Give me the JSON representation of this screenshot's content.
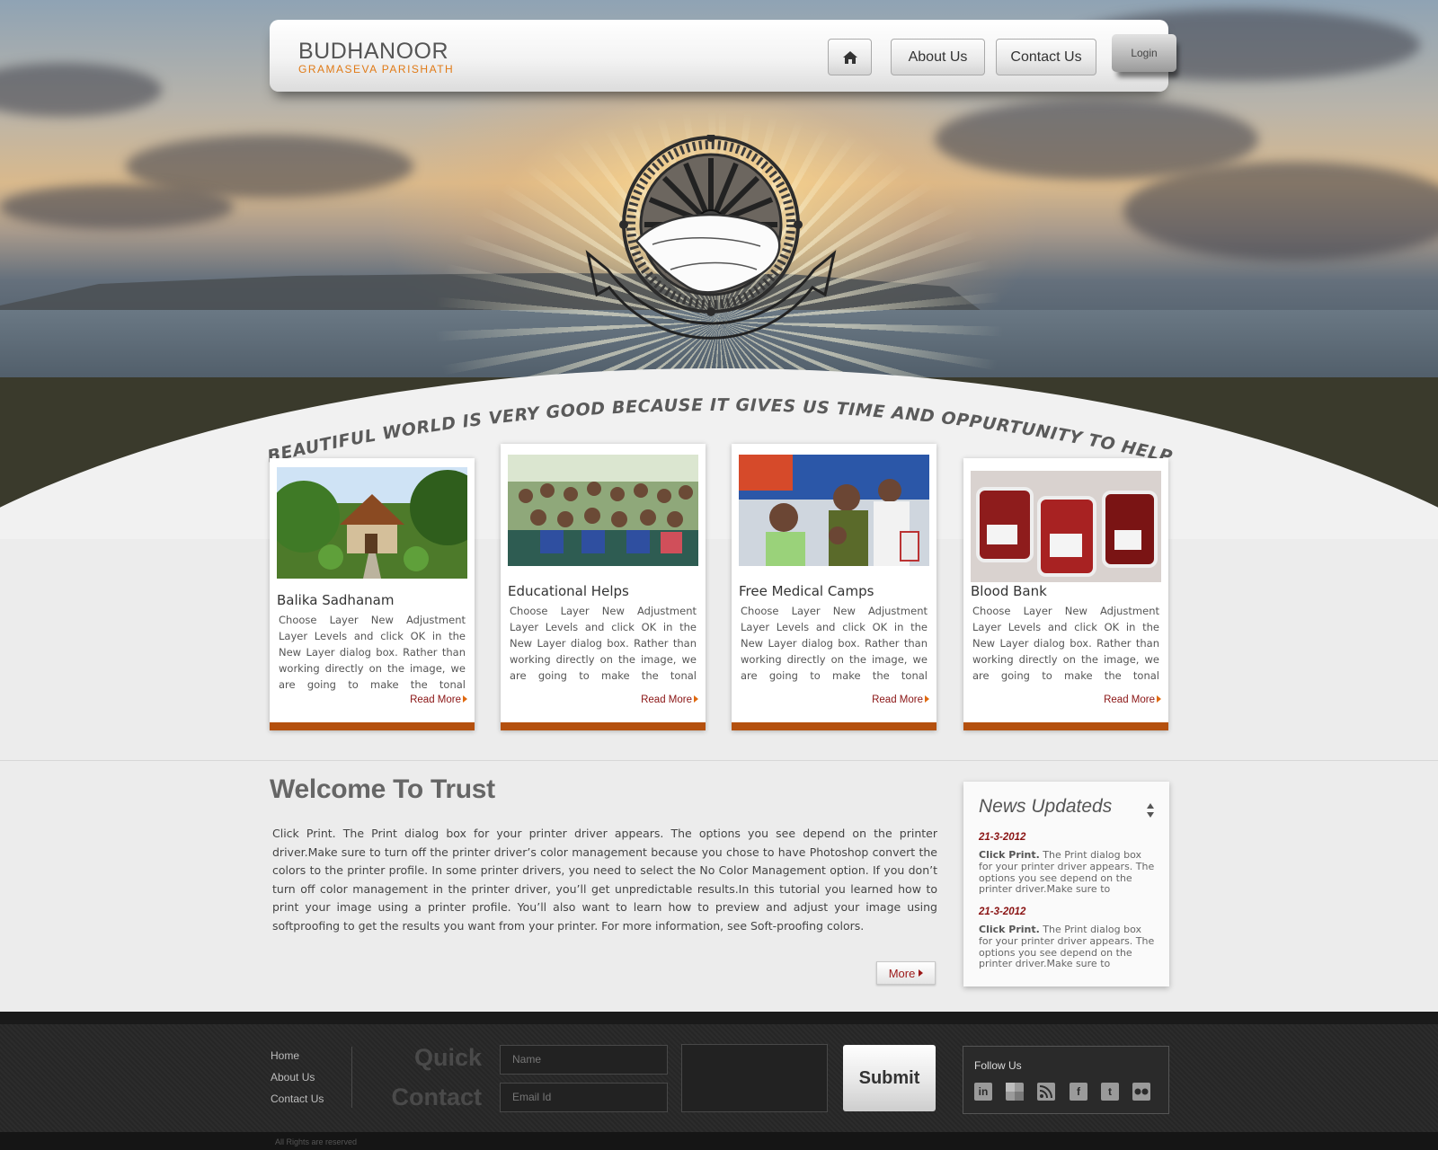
{
  "header": {
    "brand_name": "BUDHANOOR",
    "brand_tagline": "GRAMASEVA PARISHATH",
    "nav": {
      "home_icon": "home-icon",
      "about_label": "About Us",
      "contact_label": "Contact Us",
      "login_label": "Login"
    }
  },
  "hero": {
    "tagline": "ALL THIS BEAUTIFUL WORLD IS VERY GOOD BECAUSE IT GIVES US TIME AND OPPURTUNITY TO HELP OTHERS."
  },
  "cards": [
    {
      "title": "Balika Sadhanam",
      "text": "Choose Layer New Adjustment Layer Levels and click OK in the New Layer dialog box. Rather than working directly on the image, we are going to make the tonal correction in an",
      "more": "Read More"
    },
    {
      "title": "Educational Helps",
      "text": "Choose Layer New Adjustment Layer Levels and click OK in the New Layer dialog box. Rather than working directly on the image, we are going to make the tonal correction in an",
      "more": "Read More"
    },
    {
      "title": "Free Medical Camps",
      "text": "Choose Layer New Adjustment Layer Levels and click OK in the New Layer dialog box. Rather than working directly on the image, we are going to make the tonal correction in an",
      "more": "Read More"
    },
    {
      "title": "Blood Bank",
      "text": "Choose Layer New Adjustment Layer Levels and click OK in the New Layer dialog box. Rather than working directly on the image, we are going to make the tonal correction in an",
      "more": "Read More"
    }
  ],
  "welcome": {
    "title": "Welcome To Trust",
    "text": "Click Print. The Print dialog box for your printer driver appears. The options you see depend on the printer driver.Make sure to turn off the printer driver’s color management because you chose to have Photoshop convert the colors to the printer profile. In some printer drivers, you need to select the No Color Management option. If you don’t turn off color management in the printer driver, you’ll get unpredictable results.In this tutorial you learned how to print your image using a printer profile. You’ll also want to learn how to preview and adjust your image using softproofing to get the results you want from your printer. For more information, see Soft-proofing colors.",
    "more_label": "More"
  },
  "news": {
    "title": "News Updateds",
    "items": [
      {
        "date": "21-3-2012",
        "lead": "Click Print.",
        "body": " The Print dialog box for your printer driver appears. The options you see depend on the printer driver.Make sure to"
      },
      {
        "date": "21-3-2012",
        "lead": "Click Print.",
        "body": " The Print dialog box for your printer driver appears. The options you see depend on the printer driver.Make sure to"
      }
    ]
  },
  "footer": {
    "links": [
      "Home",
      "About Us",
      "Contact Us"
    ],
    "quick_contact_line1": "Quick",
    "quick_contact_line2": "Contact",
    "name_placeholder": "Name",
    "email_placeholder": "Email Id",
    "submit_label": "Submit",
    "follow_title": "Follow  Us",
    "social_icons": [
      "linkedin-icon",
      "delicious-icon",
      "rss-icon",
      "facebook-icon",
      "twitter-icon",
      "flickr-icon"
    ],
    "copyright": "All Rights are reserved"
  },
  "colors": {
    "accent_orange": "#b4500e",
    "brand_orange": "#e07a16",
    "link_red": "#8a1414"
  }
}
